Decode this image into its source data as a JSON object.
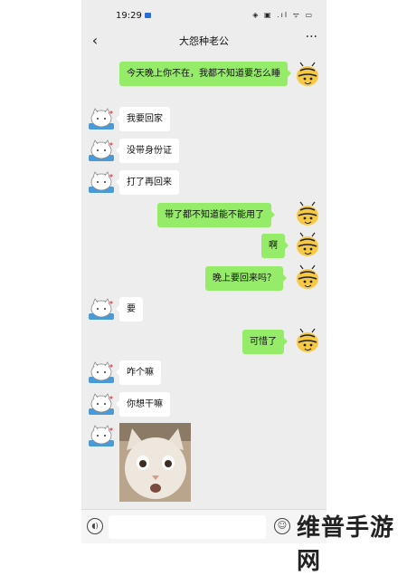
{
  "status_bar": {
    "time": "19:29",
    "indicators": "◈ ▣ .ıl ᯤ ▭"
  },
  "header": {
    "title": "大怨种老公",
    "back_icon": "‹",
    "more_icon": "···"
  },
  "messages": [
    {
      "side": "out",
      "text": "今天晚上你不在，我都不知道要怎么睡"
    },
    {
      "side": "in",
      "text": "我要回家"
    },
    {
      "side": "in",
      "text": "没带身份证"
    },
    {
      "side": "in",
      "text": "打了再回来"
    },
    {
      "side": "out",
      "text": "带了都不知道能不能用了"
    },
    {
      "side": "out",
      "text": "啊"
    },
    {
      "side": "out",
      "text": "晚上要回来吗？"
    },
    {
      "side": "in",
      "text": "要"
    },
    {
      "side": "out",
      "text": "可惜了"
    },
    {
      "side": "in",
      "text": "咋个嘛"
    },
    {
      "side": "in",
      "text": "你想干嘛"
    },
    {
      "side": "in",
      "type": "image",
      "description_icon": "shocked-cat-photo"
    }
  ],
  "input_bar": {
    "voice_icon": "voice-icon",
    "emoji_icon": "emoji-icon"
  },
  "watermark": "维普手游网",
  "colors": {
    "outgoing_bubble": "#95ec69",
    "incoming_bubble": "#ffffff",
    "chat_background": "#ededed"
  }
}
